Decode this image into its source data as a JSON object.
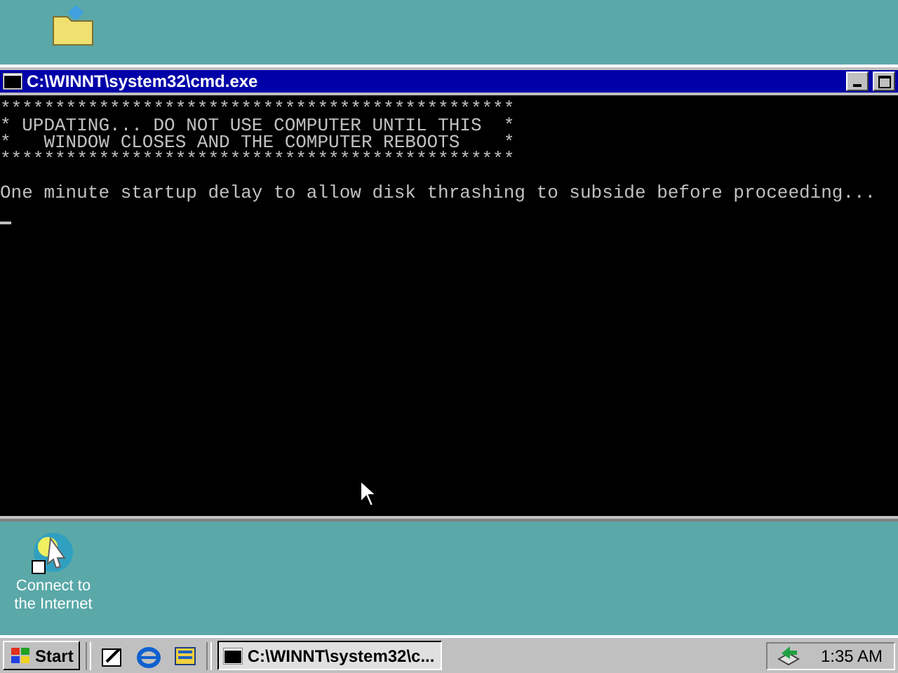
{
  "desktop_icons_top": [
    {
      "kind": "folder"
    }
  ],
  "window": {
    "title": "C:\\WINNT\\system32\\cmd.exe",
    "console_lines": [
      "***********************************************",
      "* UPDATING... DO NOT USE COMPUTER UNTIL THIS  *",
      "*   WINDOW CLOSES AND THE COMPUTER REBOOTS    *",
      "***********************************************"
    ],
    "message": "One minute startup delay to allow disk thrashing to subside before proceeding..."
  },
  "desktop_icons_bottom": [
    {
      "kind": "internet",
      "label": "Connect to\nthe Internet"
    }
  ],
  "taskbar": {
    "start": "Start",
    "quick_launch": [
      {
        "kind": "desktop"
      },
      {
        "kind": "browser"
      },
      {
        "kind": "channels"
      }
    ],
    "tasks": [
      {
        "label": "C:\\WINNT\\system32\\c...",
        "selected": true
      }
    ],
    "clock": "1:35 AM"
  }
}
